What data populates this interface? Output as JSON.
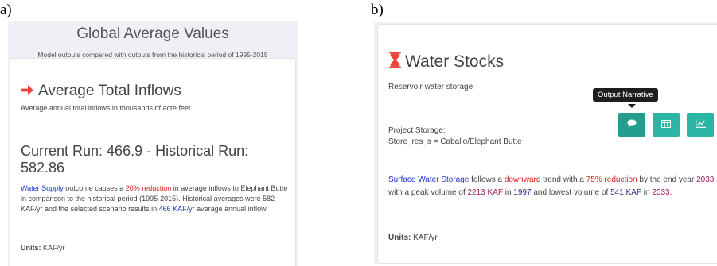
{
  "labels": {
    "a": "a)",
    "b": "b)"
  },
  "panel_a": {
    "title": "Global Average Values",
    "subtitle": "Model outputs compared with outputs from the historical period of 1995-2015",
    "card": {
      "icon": "arrow-right-icon",
      "title": "Average Total Inflows",
      "subtitle": "Average annual total inflows in thousands of acre feet",
      "run_line": "Current Run: 466.9 - Historical Run: 582.86",
      "narrative": {
        "s1": "Water Supply",
        "s2": " outcome causes a ",
        "s3": "20% reduction",
        "s4": " in average inflows to Elephant Butte in comparison to the historical period (1995-2015). Historical averages were 582 KAF/yr and the selected scenario results in ",
        "s5": "466 KAF/yr",
        "s6": " average annual inflow."
      },
      "units_label": "Units:",
      "units_value": " KAF/yr"
    }
  },
  "panel_b": {
    "card": {
      "icon": "hourglass-icon",
      "title": "Water Stocks",
      "subtitle": "Reservoir water storage",
      "tooltip": "Output Narrative",
      "buttons": [
        {
          "name": "narrative",
          "icon": "speech-bubble-icon"
        },
        {
          "name": "table",
          "icon": "table-icon"
        },
        {
          "name": "chart",
          "icon": "line-chart-icon"
        }
      ],
      "project_line1": "Project Storage:",
      "project_line2": "Store_res_s = Caballo/Elephant Butte",
      "narrative": {
        "s1": "Surface Water Storage",
        "s2": " follows a ",
        "s3": "downward",
        "s4": " trend with a ",
        "s5": "75% reduction",
        "s6": " by the end year ",
        "s7": "2033",
        "s8": " with a peak volume of ",
        "s9": "2213 KAF",
        "s10": " in ",
        "s11": "1997",
        "s12": " and lowest volume of ",
        "s13": "541 KAF",
        "s14": " in ",
        "s15": "2033",
        "s16": "."
      },
      "units_label": "Units:",
      "units_value": " KAF/yr"
    }
  },
  "colors": {
    "accent_teal": "#2bb5a4",
    "arrow_red": "#e8453c",
    "hourglass_red": "#e8453c",
    "highlight_blue": "#2233cc",
    "highlight_red": "#d21f1f"
  }
}
